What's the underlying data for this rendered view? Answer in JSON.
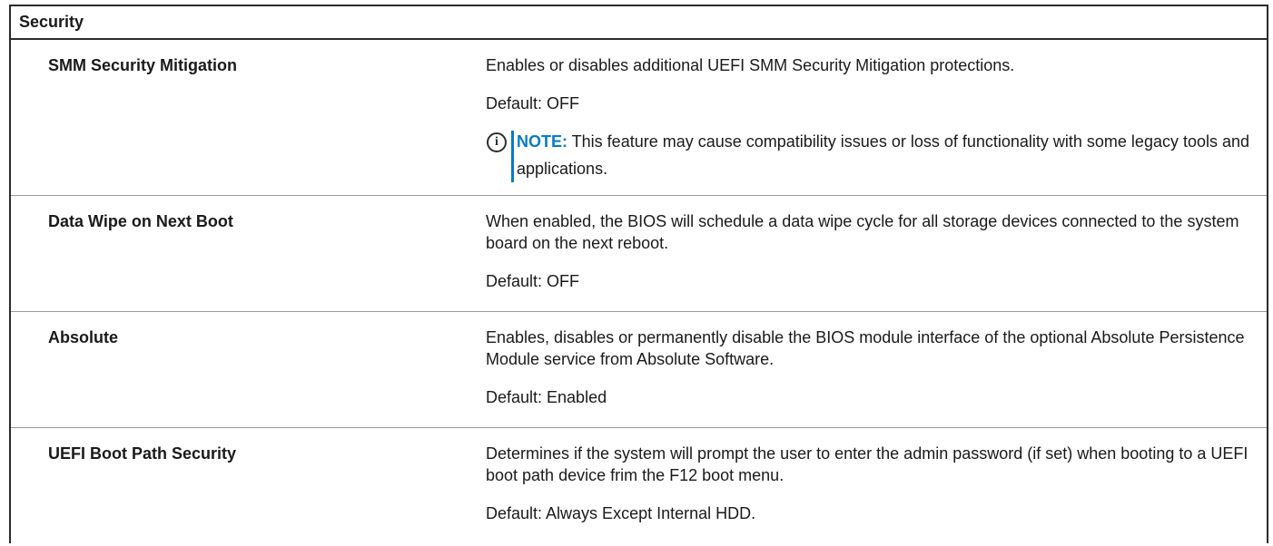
{
  "table": {
    "header": "Security",
    "rows": [
      {
        "label": "SMM Security Mitigation",
        "description": "Enables or disables additional UEFI SMM Security Mitigation protections.",
        "default": "Default: OFF",
        "note_label": "NOTE:",
        "note_text": " This feature may cause compatibility issues or loss of functionality with some legacy tools and applications."
      },
      {
        "label": "Data Wipe on Next Boot",
        "description": "When enabled, the BIOS will schedule a data wipe cycle for all storage devices connected to the system board on the next reboot.",
        "default": "Default: OFF"
      },
      {
        "label": "Absolute",
        "description": "Enables, disables or permanently disable the BIOS module interface of the optional Absolute Persistence Module service from Absolute Software.",
        "default": "Default: Enabled"
      },
      {
        "label": "UEFI Boot Path Security",
        "description": "Determines if the system will prompt the user to enter the admin password (if set) when booting to a UEFI boot path device frim the F12 boot menu.",
        "default": "Default: Always Except Internal HDD."
      }
    ]
  },
  "icons": {
    "note_icon": "info-circle-icon",
    "accent_color": "#0a7bc8"
  }
}
